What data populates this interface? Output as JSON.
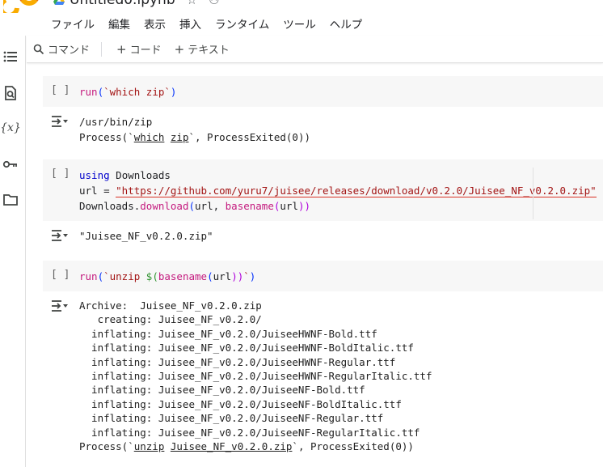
{
  "header": {
    "doc_title": "Untitled0.ipynb",
    "menu": [
      "ファイル",
      "編集",
      "表示",
      "挿入",
      "ランタイム",
      "ツール",
      "ヘルプ"
    ]
  },
  "toolbar": {
    "command_label": "コマンド",
    "add_code_label": "コード",
    "add_text_label": "テキスト"
  },
  "rail": {
    "icons": [
      "toc-icon",
      "find-icon",
      "variables-icon",
      "secrets-key-icon",
      "files-folder-icon"
    ],
    "variables_glyph": "{x}"
  },
  "cells": {
    "c1": {
      "bracket": "[ ]",
      "code": {
        "fn": "run",
        "open": "(",
        "cmd": "`which zip`",
        "close": ")"
      },
      "output": {
        "line1": "/usr/bin/zip",
        "line2_pre": "Process(`",
        "line2_a": "which",
        "line2_sp": " ",
        "line2_b": "zip",
        "line2_post": "`, ProcessExited(0))"
      }
    },
    "c2": {
      "bracket": "[ ]",
      "code": {
        "l1_kw": "using",
        "l1_mod": " Downloads",
        "l2_var": "url",
        "l2_eq": " = ",
        "l2_str": "\"https://github.com/yuru7/juisee/releases/download/v0.2.0/Juisee_NF_v0.2.0.zip\"",
        "l3_mod": "Downloads",
        "l3_dot": ".",
        "l3_fn": "download",
        "l3_open": "(",
        "l3_arg1": "url",
        "l3_comma": ", ",
        "l3_fn2": "basename",
        "l3_open2": "(",
        "l3_arg2": "url",
        "l3_close": "))"
      },
      "output": {
        "text": "\"Juisee_NF_v0.2.0.zip\""
      }
    },
    "c3": {
      "bracket": "[ ]",
      "code": {
        "fn": "run",
        "open": "(",
        "bt1": "`unzip ",
        "dollar": "$(",
        "fn2": "basename",
        "open2": "(",
        "arg": "url",
        "close2": "))",
        "bt2": "`",
        "close": ")"
      },
      "output": {
        "lines": [
          "Archive:  Juisee_NF_v0.2.0.zip",
          "   creating: Juisee_NF_v0.2.0/",
          "  inflating: Juisee_NF_v0.2.0/JuiseeHWNF-Bold.ttf",
          "  inflating: Juisee_NF_v0.2.0/JuiseeHWNF-BoldItalic.ttf",
          "  inflating: Juisee_NF_v0.2.0/JuiseeHWNF-Regular.ttf",
          "  inflating: Juisee_NF_v0.2.0/JuiseeHWNF-RegularItalic.ttf",
          "  inflating: Juisee_NF_v0.2.0/JuiseeNF-Bold.ttf",
          "  inflating: Juisee_NF_v0.2.0/JuiseeNF-BoldItalic.ttf",
          "  inflating: Juisee_NF_v0.2.0/JuiseeNF-Regular.ttf",
          "  inflating: Juisee_NF_v0.2.0/JuiseeNF-RegularItalic.ttf"
        ],
        "last_pre": "Process(`",
        "last_a": "unzip",
        "last_sp": " ",
        "last_b": "Juisee_NF_v0.2.0.zip",
        "last_post": "`, ProcessExited(0))"
      }
    }
  },
  "colors": {
    "logo_orange": "#f9ab00",
    "logo_orange_dark": "#e8710a",
    "cell_bg": "#f7f7f7",
    "keyword": "#0000cc",
    "function": "#c41a7e",
    "string": "#a31515"
  }
}
